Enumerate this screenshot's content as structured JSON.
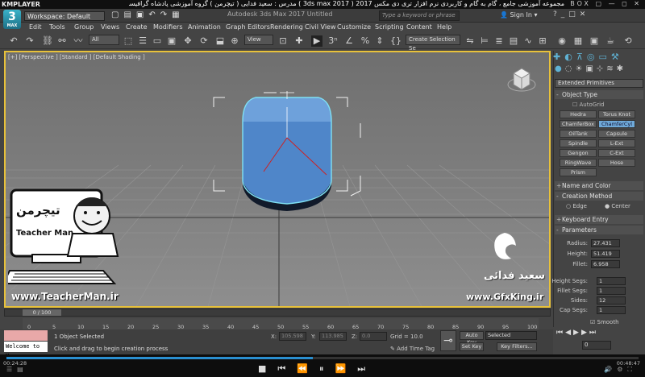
{
  "player": {
    "logo": "KMPLAYER",
    "title": "مجموعه آموزشی جامع ، گام به گام و کاربردی نرم افزار تری دی مکس 2017 ( 3ds max 2017 )   مدرس : سعید فدایی ( تیچرمن ) گروه آموزشی پادشاه گرافیست ها",
    "right_label": "BOX",
    "time_left": "00:24:28",
    "time_right": "00:48:47"
  },
  "title_bar": {
    "workspace": "Workspace: Default",
    "app_title": "Autodesk 3ds Max 2017    Untitled",
    "search_placeholder": "Type a keyword or phrase",
    "sign_in": "Sign In"
  },
  "menu": [
    "Edit",
    "Tools",
    "Group",
    "Views",
    "Create",
    "Modifiers",
    "Animation",
    "Graph Editors",
    "Rendering",
    "Civil View",
    "Customize",
    "Scripting",
    "Content",
    "Help"
  ],
  "toolbar": {
    "filter": "All",
    "ref_coord": "View",
    "selection_set": "Create Selection Se"
  },
  "viewport": {
    "label": "[+] [Perspective ] [Standard ] [Default Shading ]"
  },
  "command_panel": {
    "category": "Extended Primitives",
    "object_type_title": "Object Type",
    "autogrid": "AutoGrid",
    "primitives": [
      "Hedra",
      "Torus Knot",
      "ChamferBox",
      "ChamferCyl",
      "OilTank",
      "Capsule",
      "Spindle",
      "L-Ext",
      "Gengon",
      "C-Ext",
      "RingWave",
      "Hose",
      "Prism"
    ],
    "selected_primitive": "ChamferCyl",
    "name_color_title": "Name and Color",
    "creation_method_title": "Creation Method",
    "creation_edge": "Edge",
    "creation_center": "Center",
    "keyboard_entry_title": "Keyboard Entry",
    "parameters_title": "Parameters",
    "radius_label": "Radius:",
    "radius": "27.431",
    "height_label": "Height:",
    "height": "51.419",
    "fillet_label": "Fillet:",
    "fillet": "6.958",
    "height_segs_label": "Height Segs:",
    "height_segs": "1",
    "fillet_segs_label": "Fillet Segs:",
    "fillet_segs": "1",
    "sides_label": "Sides:",
    "sides": "12",
    "cap_segs_label": "Cap Segs:",
    "cap_segs": "1",
    "smooth_label": "Smooth"
  },
  "timeline": {
    "thumb": "0 / 100",
    "ticks": [
      "0",
      "5",
      "10",
      "15",
      "20",
      "25",
      "30",
      "35",
      "40",
      "45",
      "50",
      "55",
      "60",
      "65",
      "70",
      "75",
      "80",
      "85",
      "90",
      "95",
      "100"
    ]
  },
  "status": {
    "maxscript_text": "Welcome to M.",
    "selected": "1 Object Selected",
    "prompt": "Click and drag to begin creation process",
    "x_label": "X:",
    "x": "105.598",
    "y_label": "Y:",
    "y": "113.985",
    "z_label": "Z:",
    "z": "0.0",
    "grid": "Grid = 10.0",
    "add_time_tag": "Add Time Tag",
    "auto_key": "Auto Key",
    "set_key": "Set Key",
    "selected_filter": "Selected",
    "key_filters": "Key Filters...",
    "frame": "0"
  },
  "watermarks": {
    "teacherman_site": "www.TeacherMan.ir",
    "teacherman_logo": "تیچرمن",
    "teacherman_en": "Teacher Man",
    "gfxking_site": "www.GfxKing.ir",
    "author_name": "سعید فدائی"
  },
  "colors": {
    "cylinder": "#4f86c9",
    "selection": "#7fe1f4",
    "viewport_border": "#e8c13a",
    "accent": "#2a8fd0"
  }
}
